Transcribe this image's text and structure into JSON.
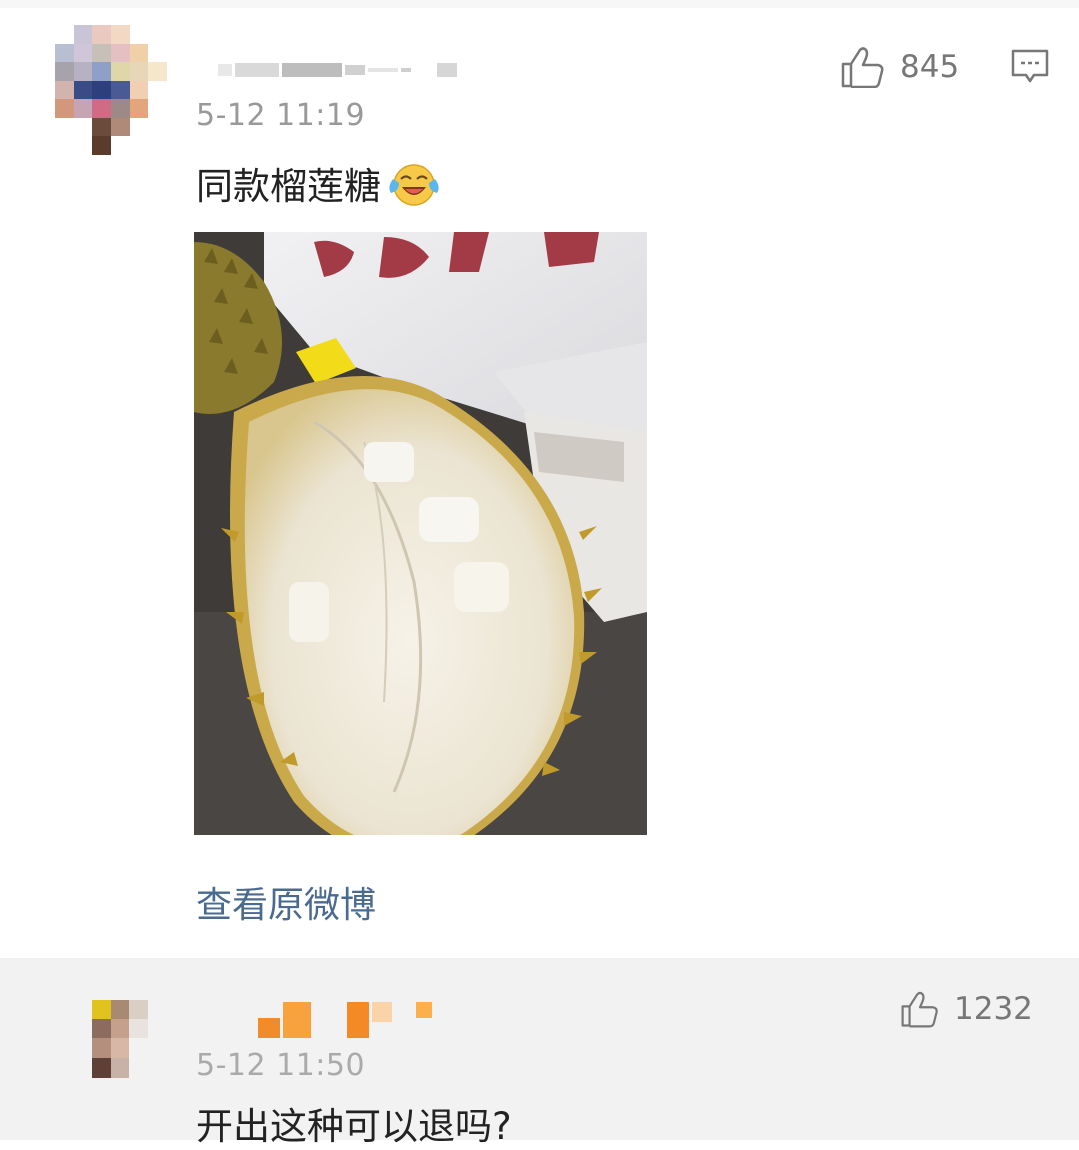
{
  "comments": [
    {
      "time": "5-12 11:19",
      "text": "同款榴莲糖",
      "emoji": "laughing-crying-emoji",
      "likes": "845",
      "view_original": "查看原微博",
      "has_photo": true
    },
    {
      "time": "5-12 11:50",
      "text": "开出这种可以退吗?",
      "likes": "1232"
    }
  ],
  "icons": {
    "like": "thumbs-up-icon",
    "reply": "comment-bubble-icon"
  },
  "colors": {
    "link": "#4a6b8f",
    "meta": "#999999",
    "body_text": "#222222",
    "second_bg": "#f2f2f2"
  }
}
